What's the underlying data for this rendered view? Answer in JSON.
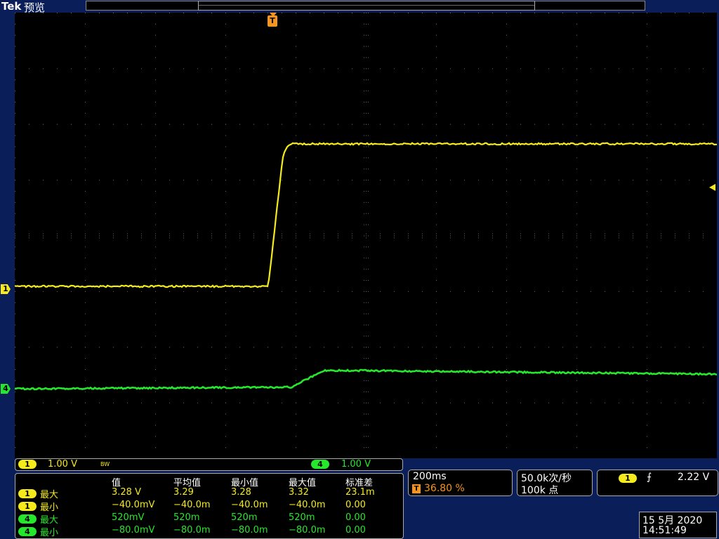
{
  "header": {
    "brand": "Tek",
    "mode": "预览"
  },
  "channels": [
    {
      "id": "1",
      "scale": "1.00 V",
      "color": "#f4ea1c"
    },
    {
      "id": "4",
      "scale": "1.00 V",
      "color": "#25e82c"
    }
  ],
  "bw_indicator": "BW",
  "trigger_marker": "T",
  "measurements": {
    "headers": [
      "值",
      "平均值",
      "最小值",
      "最大值",
      "标准差"
    ],
    "rows": [
      {
        "ch": "1",
        "type": "最大",
        "values": [
          "3.28 V",
          "3.29",
          "3.28",
          "3.32",
          "23.1m"
        ]
      },
      {
        "ch": "1",
        "type": "最小",
        "values": [
          "−40.0mV",
          "−40.0m",
          "−40.0m",
          "−40.0m",
          "0.00"
        ]
      },
      {
        "ch": "4",
        "type": "最大",
        "values": [
          "520mV",
          "520m",
          "520m",
          "520m",
          "0.00"
        ]
      },
      {
        "ch": "4",
        "type": "最小",
        "values": [
          "−80.0mV",
          "−80.0m",
          "−80.0m",
          "−80.0m",
          "0.00"
        ]
      }
    ]
  },
  "timebase": {
    "scale": "200ms",
    "trigger_marker": "T",
    "position": "36.80 %"
  },
  "acquisition": {
    "rate": "50.0k次/秒",
    "points": "100k 点"
  },
  "trigger": {
    "channel": "1",
    "slope_symbol": "⨍",
    "level": "2.22 V"
  },
  "datetime": {
    "date": "15 5月 2020",
    "time": "14:51:49"
  },
  "colors": {
    "ch1": "#f4ea1c",
    "ch4": "#25e82c",
    "trigger": "#f6941d",
    "frame": "#0a1e5a"
  }
}
